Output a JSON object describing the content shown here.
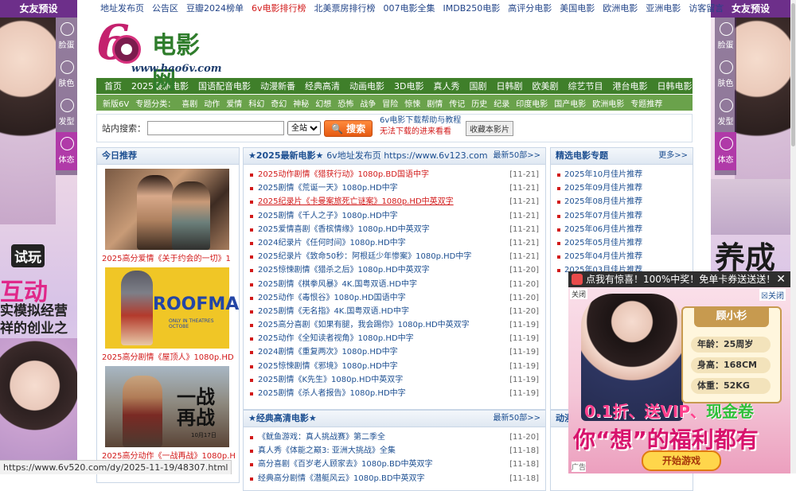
{
  "left_ad": {
    "title": "女友预设",
    "tabs": [
      "脸蛋",
      "肤色",
      "发型",
      "体态"
    ],
    "promo_play": "试玩",
    "promo_main": "互动",
    "promo_text": "实模拟经营 祥的创业之路"
  },
  "right_ad": {
    "title": "女友预设",
    "tabs": [
      "脸蛋",
      "肤色",
      "发型",
      "体态"
    ],
    "promo_text": "养成"
  },
  "topnav": [
    "地址发布页",
    "公告区",
    "豆瓣2024榜单",
    "6v电影排行榜",
    "北美票房排行榜",
    "007电影全集",
    "IMDB250电影",
    "高评分电影",
    "美国电影",
    "欧洲电影",
    "亚洲电影",
    "访客留言"
  ],
  "logo": {
    "brand": "电影网",
    "url": "www.hao6v.com"
  },
  "nav1": [
    "首页",
    "2025最新电影",
    "国语配音电影",
    "动漫新番",
    "经典高清",
    "动画电影",
    "3D电影",
    "真人秀",
    "国剧",
    "日韩剧",
    "欧美剧",
    "综艺节目",
    "港台电影",
    "日韩电影"
  ],
  "nav2": {
    "items": [
      "新版6V",
      "专题分类：",
      "喜剧",
      "动作",
      "爱情",
      "科幻",
      "奇幻",
      "神秘",
      "幻想",
      "恐怖",
      "战争",
      "冒险",
      "惊悚",
      "剧情",
      "传记",
      "历史",
      "纪录",
      "印度电影",
      "国产电影",
      "欧洲电影",
      "专题推荐"
    ]
  },
  "search": {
    "label": "站内搜索：",
    "placeholder": "",
    "scope": "全站",
    "button": "搜索",
    "help1": "6v电影下载帮助与教程",
    "help2": "无法下载的进来看看",
    "fav": "收藏本影片"
  },
  "today": {
    "title": "今日推荐",
    "posters": [
      {
        "caption": "2025高分爱情《关于约会的一切》1"
      },
      {
        "caption": "2025高分剧情《屋顶人》1080p.HD",
        "big_text": "ROOFMA",
        "small_text": "ONLY IN THEATRES OCTOBE"
      },
      {
        "caption": "2025高分动作《一战再战》1080p.H",
        "big_text": "一战 再战",
        "date": "10月17日"
      }
    ]
  },
  "latest": {
    "title": "★2025最新电影★",
    "sub": "6v地址发布页 https://www.6v123.com",
    "more": "最新50部>>",
    "items": [
      {
        "text": "2025动作剧情《猎获行动》1080p.BD国语中字",
        "date": "[11-21]",
        "style": "red"
      },
      {
        "text": "2025剧情《荒诞一天》1080p.HD中字",
        "date": "[11-21]",
        "style": ""
      },
      {
        "text": "2025纪录片《卡曼案旅死亡谜案》1080p.HD中英双字",
        "date": "[11-21]",
        "style": "under"
      },
      {
        "text": "2025剧情《千人之子》1080p.HD中字",
        "date": "[11-21]",
        "style": ""
      },
      {
        "text": "2025爱情喜剧《香槟情缘》1080p.HD中英双字",
        "date": "[11-21]",
        "style": ""
      },
      {
        "text": "2024纪录片《任何时间》1080p.HD中字",
        "date": "[11-21]",
        "style": ""
      },
      {
        "text": "2025纪录片《致命50秒：阿根廷少年惨案》1080p.HD中字",
        "date": "[11-21]",
        "style": ""
      },
      {
        "text": "2025惊悚剧情《猎杀之后》1080p.HD中英双字",
        "date": "[11-20]",
        "style": ""
      },
      {
        "text": "2025剧情《棋拳风暴》4K.国粤双语.HD中字",
        "date": "[11-20]",
        "style": ""
      },
      {
        "text": "2025动作《毒恨谷》1080p.HD国语中字",
        "date": "[11-20]",
        "style": ""
      },
      {
        "text": "2025剧情《无名指》4K.国粤双语.HD中字",
        "date": "[11-20]",
        "style": ""
      },
      {
        "text": "2025高分喜剧《如果有腿，我会踢你》1080p.HD中英双字",
        "date": "[11-19]",
        "style": ""
      },
      {
        "text": "2025动作《全知读者视角》1080p.HD中字",
        "date": "[11-19]",
        "style": ""
      },
      {
        "text": "2024剧情《重复两次》1080p.HD中字",
        "date": "[11-19]",
        "style": ""
      },
      {
        "text": "2025惊悚剧情《邪境》1080p.HD中字",
        "date": "[11-19]",
        "style": ""
      },
      {
        "text": "2025剧情《K先生》1080p.HD中英双字",
        "date": "[11-19]",
        "style": ""
      },
      {
        "text": "2025剧情《杀人者报告》1080p.HD中字",
        "date": "[11-19]",
        "style": ""
      }
    ]
  },
  "classic": {
    "title": "★经典高清电影★",
    "more": "最新50部>>",
    "items": [
      {
        "text": "《鱿鱼游戏：真人挑战赛》第二季全",
        "date": "[11-20]"
      },
      {
        "text": "真人秀《体能之巅3: 亚洲大挑战》全集",
        "date": "[11-18]"
      },
      {
        "text": "高分喜剧《百岁老人顾家去》1080p.BD中英双字",
        "date": "[11-18]"
      },
      {
        "text": "经典高分剧情《潜艇风云》1080p.BD中英双字",
        "date": "[11-18]"
      }
    ]
  },
  "topics": {
    "title": "精选电影专题",
    "more": "更多>>",
    "items": [
      "2025年10月佳片推荐",
      "2025年09月佳片推荐",
      "2025年08月佳片推荐",
      "2025年07月佳片推荐",
      "2025年06月佳片推荐",
      "2025年05月佳片推荐",
      "2025年04月佳片推荐",
      "2025年03月佳片推荐"
    ]
  },
  "anim": {
    "title": "动漫"
  },
  "popup": {
    "bar": "点我有惊喜！100%中奖！免单卡券送送送！",
    "tag": "关闭",
    "close": "关闭",
    "name": "顾小杉",
    "age": "年龄：25周岁",
    "height": "身高：168CM",
    "weight": "体重：52KG",
    "slogan1a": "0.1折、送VIP、",
    "slogan1b": "现金卷",
    "slogan2": "你“想”的福利都有",
    "start": "开始游戏",
    "adtag": "广告"
  },
  "status_url": "https://www.6v520.com/dy/2025-11-19/48307.html"
}
